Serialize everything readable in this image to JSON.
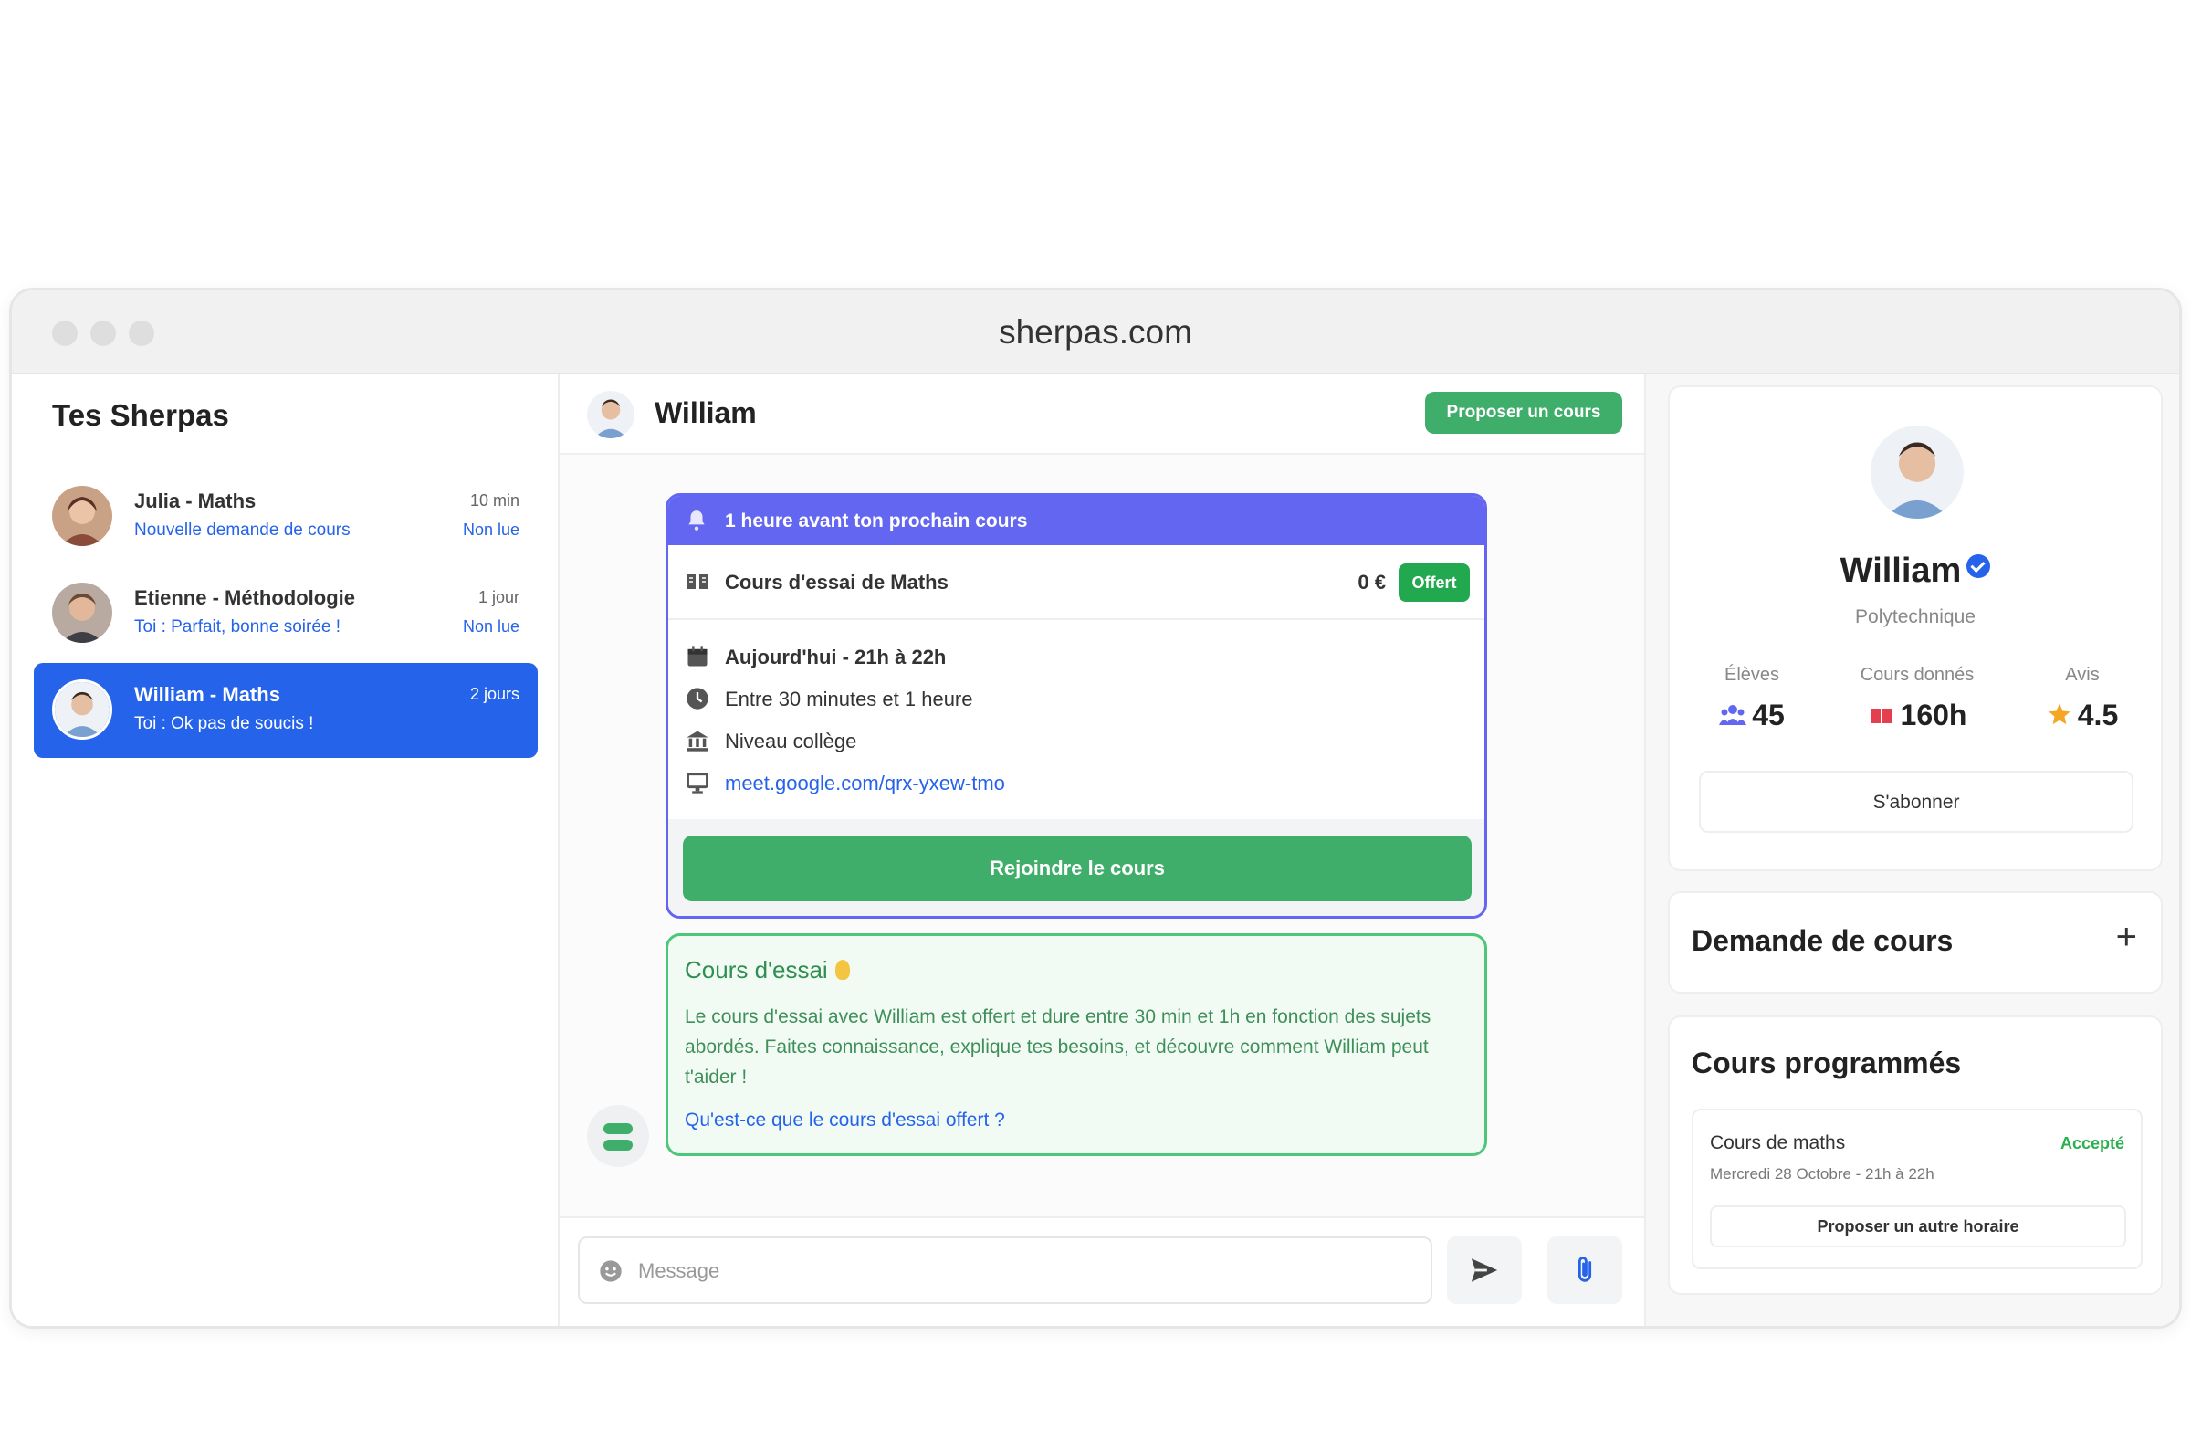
{
  "browser": {
    "url": "sherpas.com"
  },
  "sidebar": {
    "title": "Tes Sherpas",
    "conversations": [
      {
        "name": "Julia - Maths",
        "preview": "Nouvelle demande de cours",
        "time": "10 min",
        "status": "Non lue"
      },
      {
        "name": "Etienne - Méthodologie",
        "preview": "Toi : Parfait, bonne soirée !",
        "time": "1 jour",
        "status": "Non lue"
      },
      {
        "name": "William - Maths",
        "preview": "Toi : Ok pas de soucis !",
        "time": "2 jours",
        "status": ""
      }
    ]
  },
  "chat": {
    "contact_name": "William",
    "propose_button": "Proposer un cours",
    "next_lesson": {
      "banner": "1 heure avant ton prochain cours",
      "title": "Cours d'essai de Maths",
      "price": "0 €",
      "badge": "Offert",
      "date": "Aujourd'hui - 21h à 22h",
      "duration": "Entre 30 minutes et 1 heure",
      "level": "Niveau collège",
      "link": "meet.google.com/qrx-yxew-tmo",
      "join_button": "Rejoindre le cours"
    },
    "trial_info": {
      "title": "Cours d'essai",
      "text": "Le cours d'essai avec William est offert et dure entre 30 min et 1h en fonction des sujets abordés. Faites connaissance, explique tes besoins, et découvre comment William peut t'aider !",
      "link": "Qu'est-ce que le cours d'essai offert ?"
    },
    "message_placeholder": "Message"
  },
  "profile": {
    "name": "William",
    "school": "Polytechnique",
    "stats": [
      {
        "label": "Élèves",
        "value": "45"
      },
      {
        "label": "Cours donnés",
        "value": "160h"
      },
      {
        "label": "Avis",
        "value": "4.5"
      }
    ],
    "subscribe_button": "S'abonner"
  },
  "demand": {
    "title": "Demande de cours",
    "add": "+"
  },
  "scheduled": {
    "title": "Cours programmés",
    "course": {
      "name": "Cours de maths",
      "status": "Accepté",
      "date": "Mercredi 28 Octobre - 21h à 22h",
      "button": "Proposer un autre horaire"
    }
  },
  "colors": {
    "primary_blue": "#2563eb",
    "indigo": "#6366f1",
    "green": "#3fae6a",
    "accepted": "#2bb04f"
  }
}
